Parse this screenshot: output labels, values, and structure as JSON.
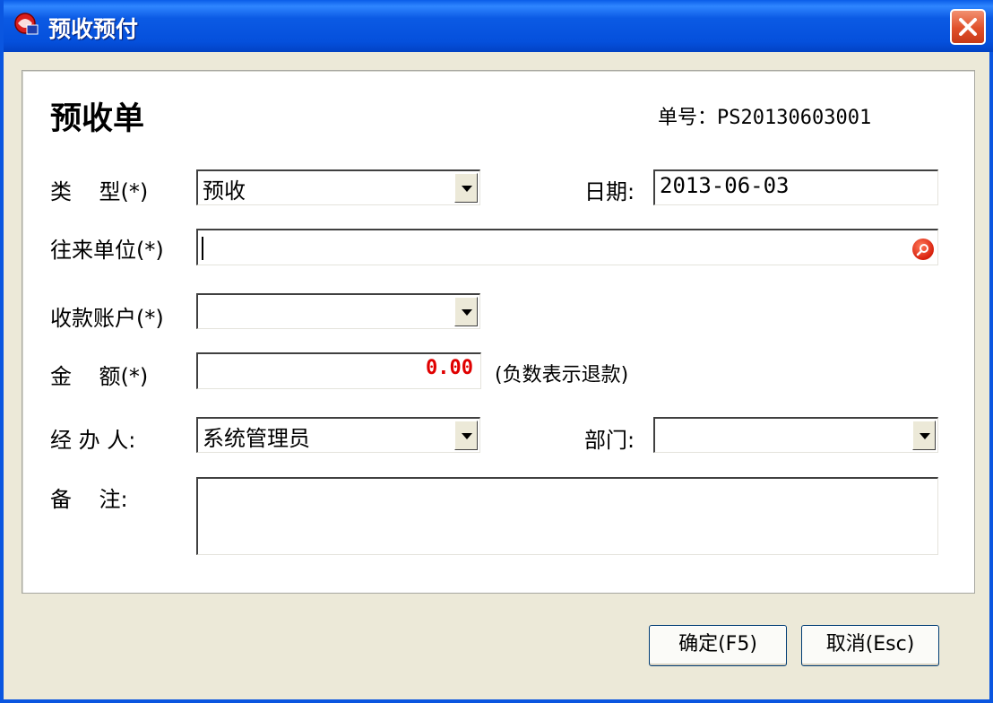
{
  "window": {
    "title": "预收预付"
  },
  "form": {
    "heading": "预收单",
    "bill_no_label": "单号：",
    "bill_no": "PS20130603001",
    "type_label": "类    型(*)",
    "type_value": "预收",
    "date_label": "日期:",
    "date_value": "2013-06-03",
    "partner_label": "往来单位(*)",
    "partner_value": "",
    "account_label": "收款账户(*)",
    "account_value": "",
    "amount_label": "金    额(*)",
    "amount_value": "0.00",
    "amount_note": "(负数表示退款)",
    "handler_label": "经 办 人:",
    "handler_value": "系统管理员",
    "dept_label": "部门:",
    "dept_value": "",
    "remark_label": "备    注:",
    "remark_value": ""
  },
  "buttons": {
    "ok": "确定(F5)",
    "cancel": "取消(Esc)"
  },
  "colors": {
    "titlebar": "#0a5de8",
    "amount": "#e00000",
    "close": "#e0502a"
  }
}
